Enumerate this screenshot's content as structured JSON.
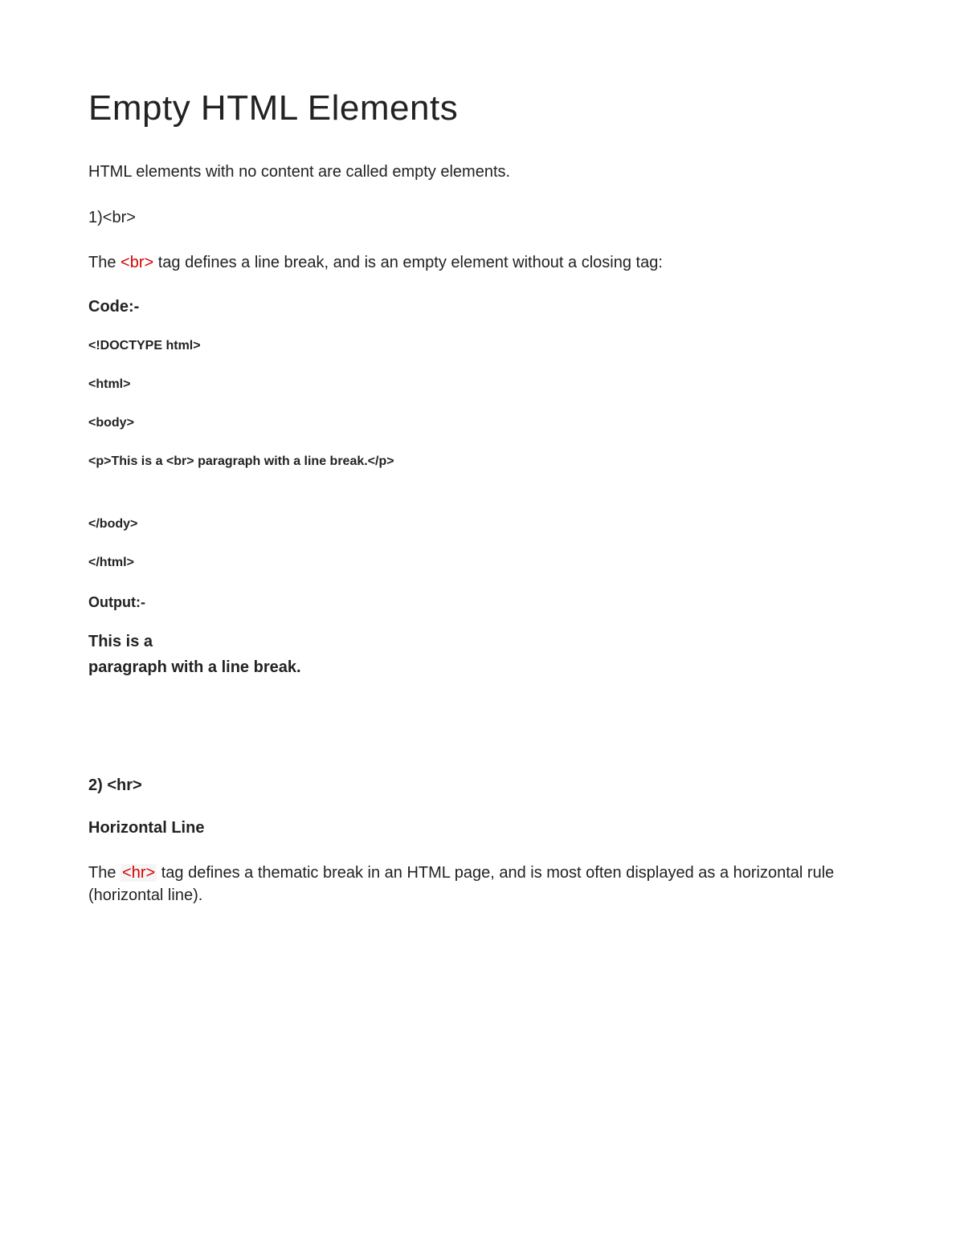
{
  "title": "Empty HTML Elements",
  "intro": "HTML elements with no content are called empty elements.",
  "section1": {
    "num": "1)<br>",
    "desc_pre": "The ",
    "desc_tag": "<br>",
    "desc_post": " tag defines a line break, and is an empty element without a closing tag:",
    "code_label": "Code:-",
    "code_lines": {
      "l1": "<!DOCTYPE html>",
      "l2": "<html>",
      "l3": "<body>",
      "l4": "<p>This is a <br> paragraph with a line break.</p>",
      "l5": "</body>",
      "l6": "</html>"
    },
    "output_label": "Output:-",
    "output_line1": "This is a",
    "output_line2": "paragraph with a line break."
  },
  "section2": {
    "num": "2) <hr>",
    "sub": "Horizontal Line",
    "desc_pre": "The ",
    "desc_tag": "<hr>",
    "desc_post": " tag defines a thematic break in an HTML page, and is most often displayed as a horizontal rule (horizontal line)."
  }
}
